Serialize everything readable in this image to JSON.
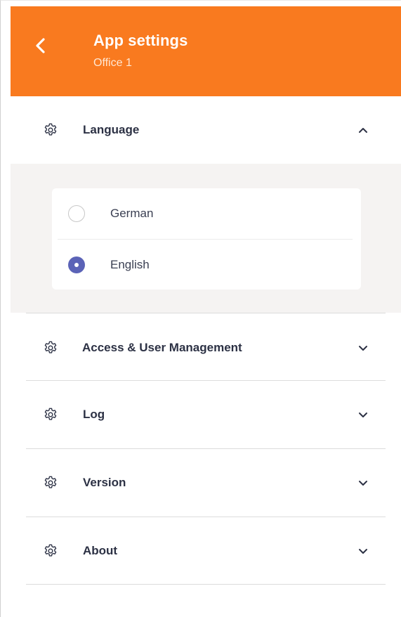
{
  "header": {
    "title": "App settings",
    "subtitle": "Office 1",
    "back_icon": "chevron-left-icon",
    "background_color": "#f97a1f"
  },
  "sections": [
    {
      "label": "Language",
      "icon": "gear-icon",
      "expanded": true
    },
    {
      "label": "Access & User Management",
      "icon": "gear-icon",
      "expanded": false
    },
    {
      "label": "Log",
      "icon": "gear-icon",
      "expanded": false
    },
    {
      "label": "Version",
      "icon": "gear-icon",
      "expanded": false
    },
    {
      "label": "About",
      "icon": "gear-icon",
      "expanded": false
    }
  ],
  "language": {
    "options": [
      {
        "label": "German",
        "selected": false
      },
      {
        "label": "English",
        "selected": true
      }
    ],
    "radio_color": "#5b63b7"
  }
}
